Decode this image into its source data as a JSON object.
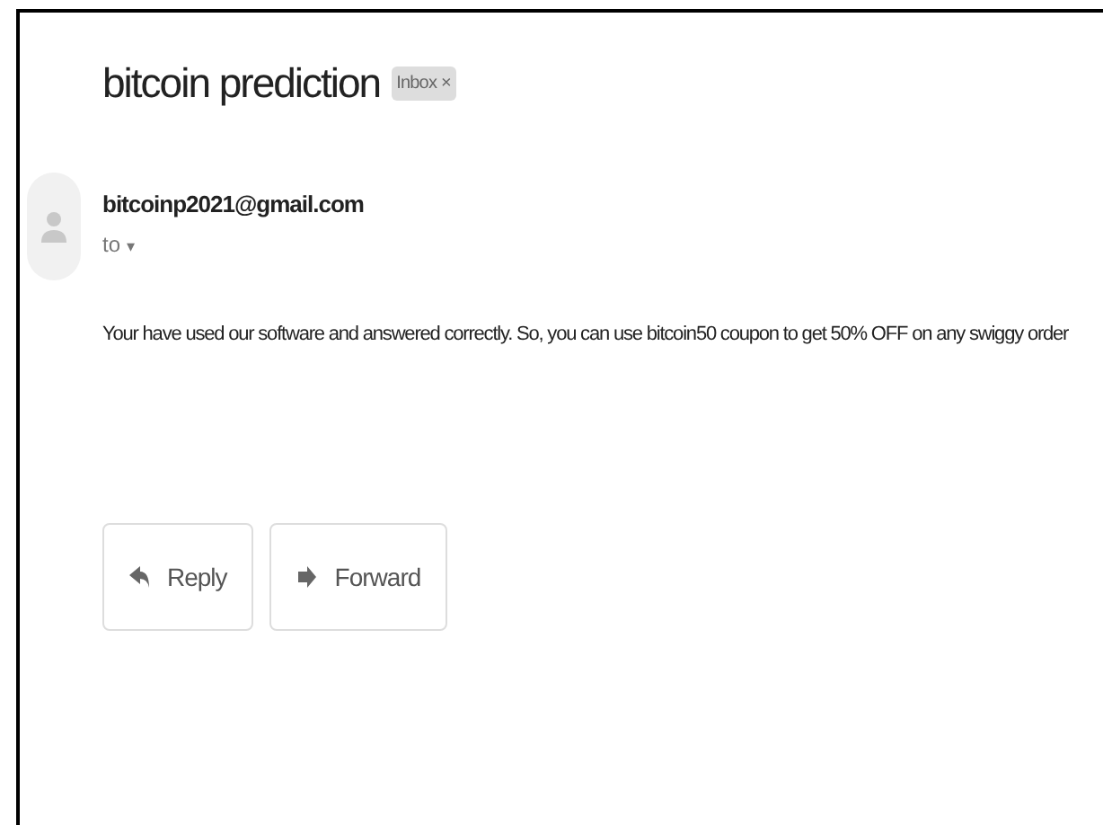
{
  "subject": "bitcoin prediction",
  "label": {
    "text": "Inbox",
    "close": "×"
  },
  "sender": {
    "email": "bitcoinp2021@gmail.com",
    "to": "to",
    "caret": "▾"
  },
  "body": "Your have used our software and answered correctly. So, you can use bitcoin50 coupon to get 50% OFF on any swiggy order",
  "actions": [
    {
      "kind": "reply",
      "label": "Reply"
    },
    {
      "kind": "forward",
      "label": "Forward"
    }
  ]
}
